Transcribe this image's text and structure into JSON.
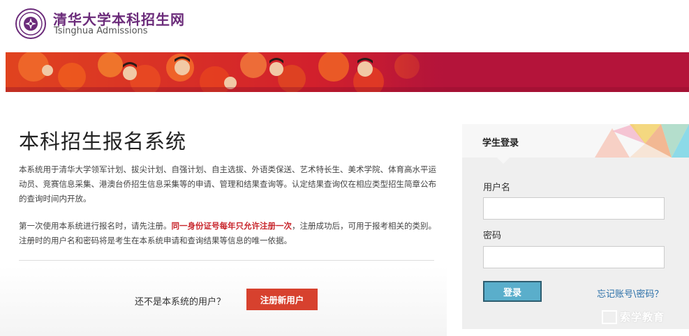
{
  "header": {
    "title": "清华大学本科招生网",
    "subtitle": "Tsinghua Admissions"
  },
  "main": {
    "title": "本科招生报名系统",
    "para1": "本系统用于清华大学领军计划、拔尖计划、自强计划、自主选拔、外语类保送、艺术特长生、美术学院、体育高水平运动员、竞赛信息采集、港澳台侨招生信息采集等的申请、管理和结果查询等。认定结果查询仅在相应类型招生简章公布的查询时间内开放。",
    "para2_before": "第一次使用本系统进行报名时，请先注册。",
    "para2_highlight": "同一身份证号每年只允许注册一次",
    "para2_after": "，注册成功后，可用于报考相关的类别。注册时的用户名和密码将是考生在本系统申请和查询结果等信息的唯一依据。",
    "register_question": "还不是本系统的用户？",
    "register_button": "注册新用户"
  },
  "login": {
    "title": "学生登录",
    "username_label": "用户名",
    "username_value": "",
    "password_label": "密码",
    "password_value": "",
    "login_button": "登录",
    "forgot_link": "忘记账号\\密码？"
  },
  "watermark": {
    "text": "索学教育"
  },
  "colors": {
    "brand_purple": "#6b2b7a",
    "banner_red": "#b4143a",
    "highlight_red": "#c8262c",
    "register_button": "#d7412e",
    "login_button": "#5aaecb",
    "link_blue": "#2a6fa8"
  },
  "icons": {
    "logo": "university-emblem-icon",
    "watermark": "watermark-logo-icon"
  }
}
